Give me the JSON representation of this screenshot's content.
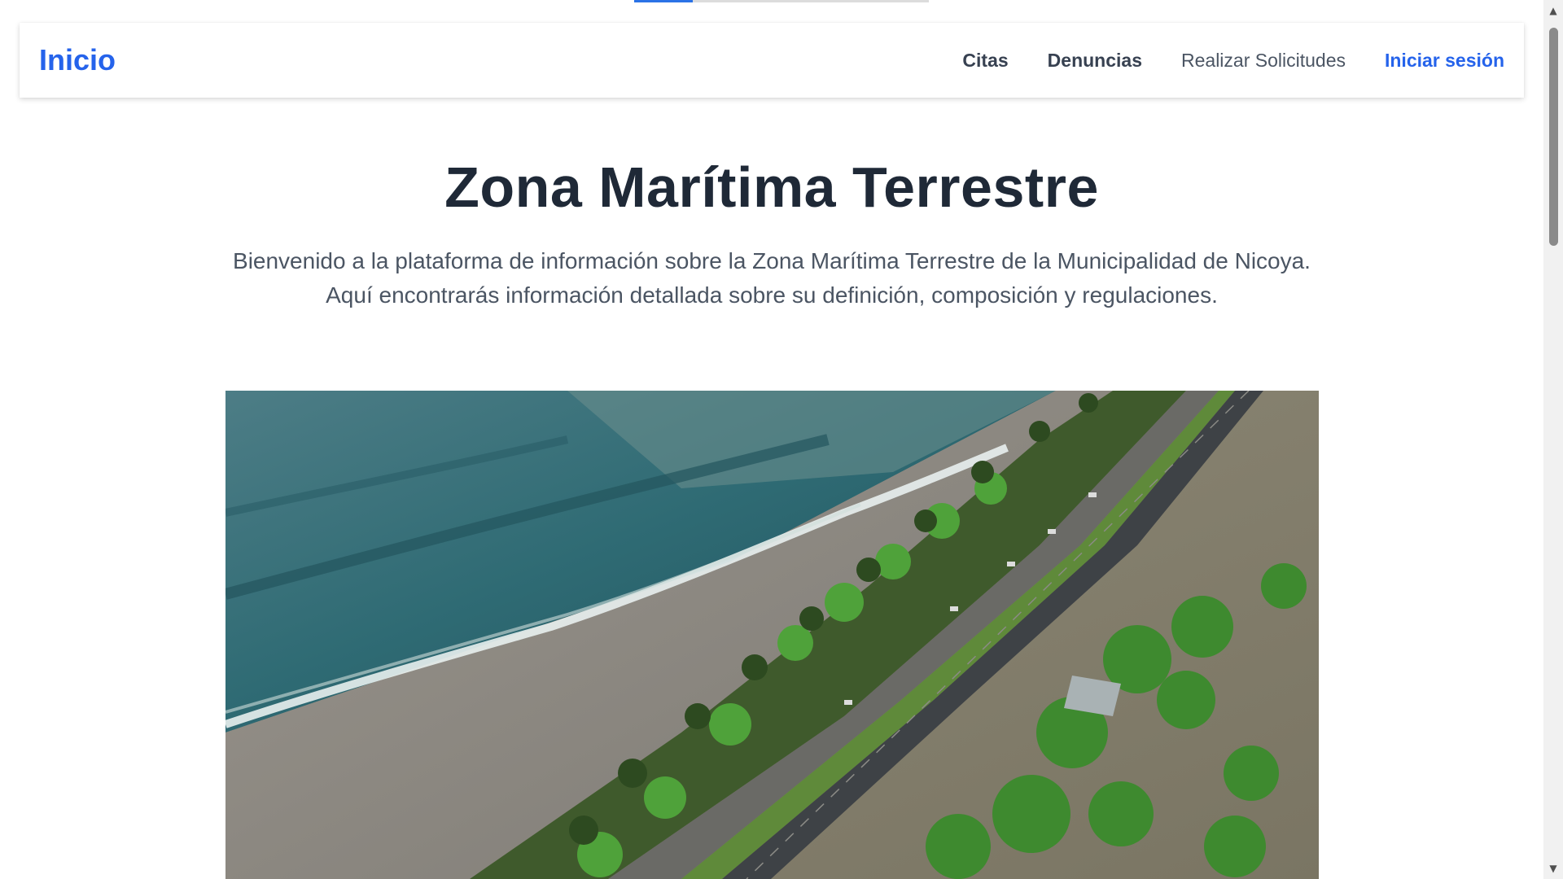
{
  "header": {
    "brand": "Inicio",
    "nav": {
      "citas": "Citas",
      "denuncias": "Denuncias",
      "solicitudes": "Realizar Solicitudes",
      "login": "Iniciar sesión"
    }
  },
  "hero": {
    "title": "Zona Marítima Terrestre",
    "subtitle": "Bienvenido a la plataforma de información sobre la Zona Marítima Terrestre de la Municipalidad de Nicoya. Aquí encontrarás información detallada sobre su definición, composición y regulaciones."
  },
  "colors": {
    "accent": "#2563eb",
    "title": "#1f2937",
    "text": "#4b5563"
  },
  "page_load_progress": 0.2
}
